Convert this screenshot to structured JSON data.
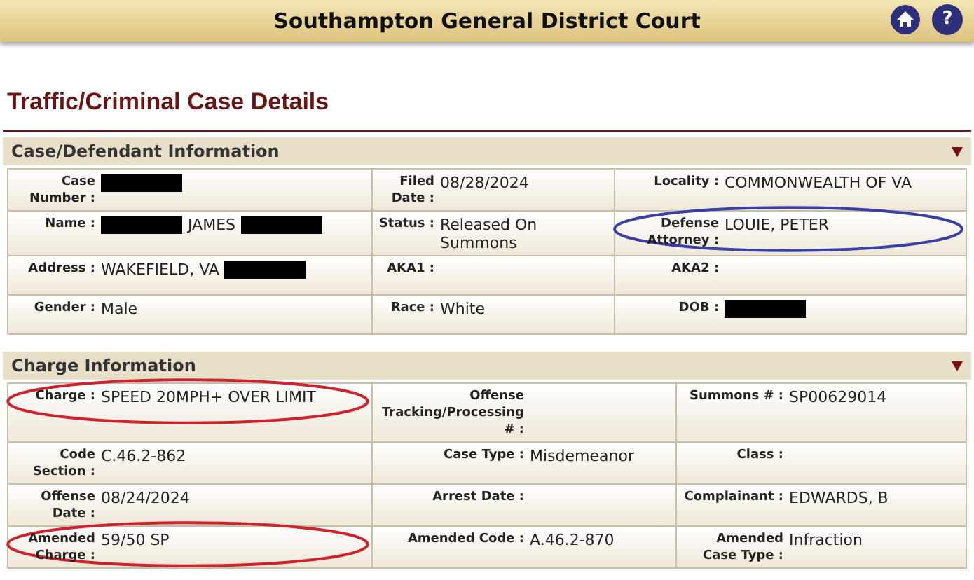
{
  "header": {
    "title": "Southampton General District Court",
    "help_glyph": "?"
  },
  "page_title": "Traffic/Criminal Case Details",
  "sections": [
    {
      "title": "Case/Defendant Information",
      "expanded": true,
      "rows": [
        [
          {
            "label": "Case Number :",
            "value": [
              {
                "kind": "redacted"
              }
            ]
          },
          {
            "label": "Filed Date :",
            "value": [
              {
                "kind": "text",
                "text": "08/28/2024"
              }
            ]
          },
          {
            "label": "Locality :",
            "value": [
              {
                "kind": "text",
                "text": "COMMONWEALTH OF VA"
              }
            ]
          }
        ],
        [
          {
            "label": "Name :",
            "value": [
              {
                "kind": "redacted"
              },
              {
                "kind": "text",
                "text": "JAMES"
              },
              {
                "kind": "redacted"
              }
            ]
          },
          {
            "label": "Status :",
            "value": [
              {
                "kind": "text",
                "text": "Released On Summons"
              }
            ]
          },
          {
            "label": "Defense Attorney :",
            "value": [
              {
                "kind": "text",
                "text": "LOUIE, PETER"
              }
            ],
            "color": "#3a3fa8"
          }
        ],
        [
          {
            "label": "Address :",
            "value": [
              {
                "kind": "text",
                "text": "WAKEFIELD, VA"
              },
              {
                "kind": "redacted"
              }
            ]
          },
          {
            "label": "AKA1 :"
          },
          {
            "label": "AKA2 :"
          }
        ],
        [
          {
            "label": "Gender :",
            "value": [
              {
                "kind": "text",
                "text": "Male"
              }
            ]
          },
          {
            "label": "Race :",
            "value": [
              {
                "kind": "text",
                "text": "White"
              }
            ]
          },
          {
            "label": "DOB :",
            "value": [
              {
                "kind": "redacted"
              }
            ]
          }
        ]
      ]
    },
    {
      "title": "Charge Information",
      "expanded": true,
      "rows": [
        [
          {
            "label": "Charge :",
            "value": [
              {
                "kind": "text",
                "text": "SPEED 20MPH+ OVER LIMIT"
              }
            ],
            "color": "#d0222c"
          },
          {
            "label": "Offense Tracking/Processing # :"
          },
          {
            "label": "Summons # :",
            "value": [
              {
                "kind": "text",
                "text": "SP00629014"
              }
            ]
          }
        ],
        [
          {
            "label": "Code Section :",
            "value": [
              {
                "kind": "text",
                "text": "C.46.2-862"
              }
            ]
          },
          {
            "label": "Case Type :",
            "value": [
              {
                "kind": "text",
                "text": "Misdemeanor"
              }
            ]
          },
          {
            "label": "Class :"
          }
        ],
        [
          {
            "label": "Offense Date :",
            "value": [
              {
                "kind": "text",
                "text": "08/24/2024"
              }
            ]
          },
          {
            "label": "Arrest Date :"
          },
          {
            "label": "Complainant :",
            "value": [
              {
                "kind": "text",
                "text": "EDWARDS, B"
              }
            ]
          }
        ],
        [
          {
            "label": "Amended Charge :",
            "value": [
              {
                "kind": "text",
                "text": "59/50 SP"
              }
            ],
            "color": "#d0222c"
          },
          {
            "label": "Amended Code :",
            "value": [
              {
                "kind": "text",
                "text": "A.46.2-870"
              }
            ]
          },
          {
            "label": "Amended Case Type :",
            "value": [
              {
                "kind": "text",
                "text": "Infraction"
              }
            ]
          }
        ]
      ]
    }
  ]
}
